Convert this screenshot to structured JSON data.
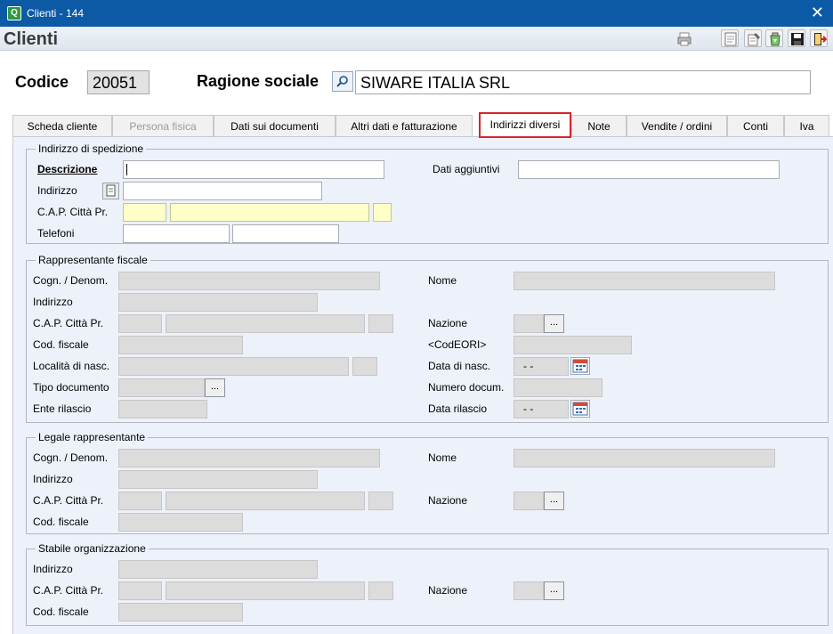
{
  "window": {
    "title": "Clienti - 144",
    "close_glyph": "✕",
    "app_icon": "Q"
  },
  "header": {
    "title": "Clienti"
  },
  "record": {
    "codice_label": "Codice",
    "codice_value": "20051",
    "ragione_label": "Ragione sociale",
    "ragione_value": "SIWARE ITALIA SRL"
  },
  "tabs": [
    {
      "label": "Scheda cliente"
    },
    {
      "label": "Persona fisica"
    },
    {
      "label": "Dati sui documenti"
    },
    {
      "label": "Altri dati e fatturazione"
    },
    {
      "label": "Indirizzi diversi"
    },
    {
      "label": "Note"
    },
    {
      "label": "Vendite / ordini"
    },
    {
      "label": "Conti"
    },
    {
      "label": "Iva"
    }
  ],
  "spedizione": {
    "title": "Indirizzo di spedizione",
    "descrizione": "Descrizione",
    "dati_aggiuntivi": "Dati aggiuntivi",
    "indirizzo": "Indirizzo",
    "cap_citta_pr": "C.A.P.  Città  Pr.",
    "telefoni": "Telefoni"
  },
  "rappresentante": {
    "title": "Rappresentante fiscale",
    "cognome": "Cogn. / Denom.",
    "nome": "Nome",
    "indirizzo": "Indirizzo",
    "cap_citta_pr": "C.A.P.  Città  Pr.",
    "nazione": "Nazione",
    "cod_fiscale": "Cod. fiscale",
    "codeori": "<CodEORI>",
    "localita_nasc": "Località di nasc.",
    "data_nasc": "Data di nasc.",
    "data_nasc_value": "-  -",
    "tipo_documento": "Tipo documento",
    "numero_docum": "Numero docum.",
    "ente_rilascio": "Ente rilascio",
    "data_rilascio": "Data rilascio",
    "data_rilascio_value": "-  -"
  },
  "legale": {
    "title": "Legale rappresentante",
    "cognome": "Cogn. / Denom.",
    "nome": "Nome",
    "indirizzo": "Indirizzo",
    "cap_citta_pr": "C.A.P.  Città  Pr.",
    "nazione": "Nazione",
    "cod_fiscale": "Cod. fiscale"
  },
  "stabile": {
    "title": "Stabile organizzazione",
    "indirizzo": "Indirizzo",
    "cap_citta_pr": "C.A.P.  Città  Pr.",
    "nazione": "Nazione",
    "cod_fiscale": "Cod. fiscale"
  },
  "buttons": {
    "dots": "..."
  },
  "colors": {
    "titlebar": "#0c5aa6",
    "panel": "#edf1f9",
    "active_tab_border": "#d6262b",
    "required_field": "#ffffc8"
  }
}
